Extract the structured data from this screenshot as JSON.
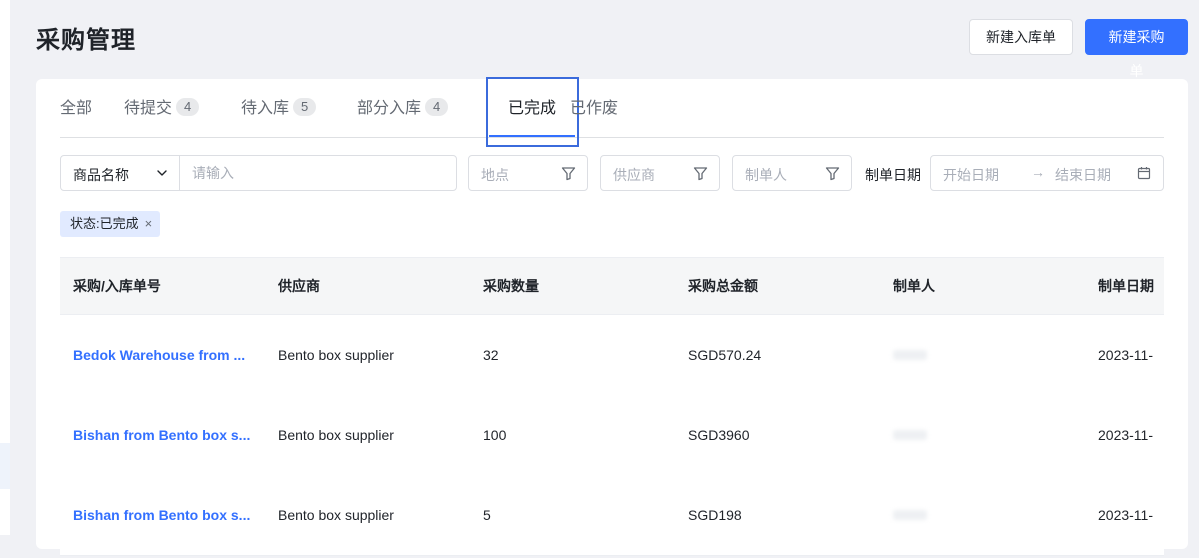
{
  "page": {
    "title": "采购管理"
  },
  "actions": {
    "new_inbound": "新建入库单",
    "new_purchase": "新建采购单"
  },
  "tabs": [
    {
      "label": "全部",
      "count": null
    },
    {
      "label": "待提交",
      "count": "4"
    },
    {
      "label": "待入库",
      "count": "5"
    },
    {
      "label": "部分入库",
      "count": "4"
    },
    {
      "label": "已完成",
      "count": null,
      "active": true
    },
    {
      "label": "已作废",
      "count": null
    }
  ],
  "filters": {
    "field_select": "商品名称",
    "search_placeholder": "请输入",
    "location_placeholder": "地点",
    "supplier_placeholder": "供应商",
    "creator_placeholder": "制单人",
    "date_label": "制单日期",
    "start_date_placeholder": "开始日期",
    "end_date_placeholder": "结束日期",
    "date_separator": "→"
  },
  "active_filter_tag": {
    "label": "状态:已完成",
    "close": "×"
  },
  "table": {
    "columns": [
      "采购/入库单号",
      "供应商",
      "采购数量",
      "采购总金额",
      "制单人",
      "制单日期"
    ],
    "rows": [
      {
        "order_no": "Bedok Warehouse from ...",
        "supplier": "Bento box supplier",
        "quantity": "32",
        "amount": "SGD570.24",
        "date": "2023-11-"
      },
      {
        "order_no": "Bishan from Bento box s...",
        "supplier": "Bento box supplier",
        "quantity": "100",
        "amount": "SGD3960",
        "date": "2023-11-"
      },
      {
        "order_no": "Bishan from Bento box s...",
        "supplier": "Bento box supplier",
        "quantity": "5",
        "amount": "SGD198",
        "date": "2023-11-"
      }
    ]
  },
  "colors": {
    "primary": "#3370ff",
    "background": "#f0f1f5",
    "focus_outline": "#3b6bdc"
  },
  "icons": [
    "chevron-down-icon",
    "filter-icon",
    "calendar-icon",
    "close-icon"
  ]
}
